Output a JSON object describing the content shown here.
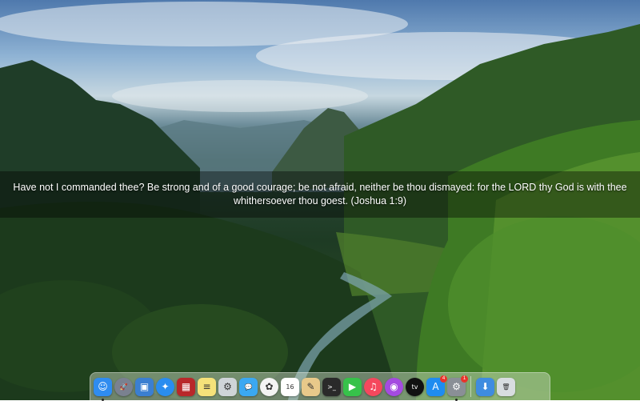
{
  "verse": {
    "text": "Have not I commanded thee? Be strong and of a good courage; be not afraid, neither be thou dismayed: for the LORD thy God is with thee whithersoever thou goest. (Joshua 1:9)"
  },
  "dock": {
    "items": [
      {
        "name": "finder-icon",
        "glyph": "☺",
        "color": "#2f8cf0",
        "running": true
      },
      {
        "name": "launchpad-icon",
        "glyph": "🚀",
        "color": "#7a8190",
        "round": true
      },
      {
        "name": "preview-icon",
        "glyph": "▣",
        "color": "#3b7fd1"
      },
      {
        "name": "safari-icon",
        "glyph": "✦",
        "color": "#2a8df0",
        "round": true
      },
      {
        "name": "photo-booth-icon",
        "glyph": "▦",
        "color": "#b8282a"
      },
      {
        "name": "notes-icon",
        "glyph": "≡",
        "color": "#f5e27a"
      },
      {
        "name": "utility-icon",
        "glyph": "⚙",
        "color": "#cfd4d8"
      },
      {
        "name": "messages-icon",
        "glyph": "💬",
        "color": "#3ba8f2"
      },
      {
        "name": "photos-icon",
        "glyph": "✿",
        "color": "#f4f4f4",
        "round": true
      },
      {
        "name": "calendar-icon",
        "glyph": "16",
        "color": "#ffffff"
      },
      {
        "name": "script-editor-icon",
        "glyph": "✎",
        "color": "#e8c98a"
      },
      {
        "name": "terminal-icon",
        "glyph": ">_",
        "color": "#2a2a2a"
      },
      {
        "name": "facetime-icon",
        "glyph": "▶",
        "color": "#37c24a"
      },
      {
        "name": "music-icon",
        "glyph": "♫",
        "color": "#f5485d",
        "round": true
      },
      {
        "name": "podcasts-icon",
        "glyph": "◉",
        "color": "#a44be0",
        "round": true
      },
      {
        "name": "apple-tv-icon",
        "glyph": "tv",
        "color": "#111111",
        "round": true
      },
      {
        "name": "app-store-icon",
        "glyph": "A",
        "color": "#1f8cf0",
        "badge": "4"
      },
      {
        "name": "system-preferences-icon",
        "glyph": "⚙",
        "color": "#8a8f96",
        "badge": "1",
        "running": true
      },
      {
        "name": "separator"
      },
      {
        "name": "downloads-folder-icon",
        "glyph": "⬇",
        "color": "#3f8ce0"
      },
      {
        "name": "trash-icon",
        "glyph": "🗑",
        "color": "#d8dde0"
      }
    ]
  }
}
